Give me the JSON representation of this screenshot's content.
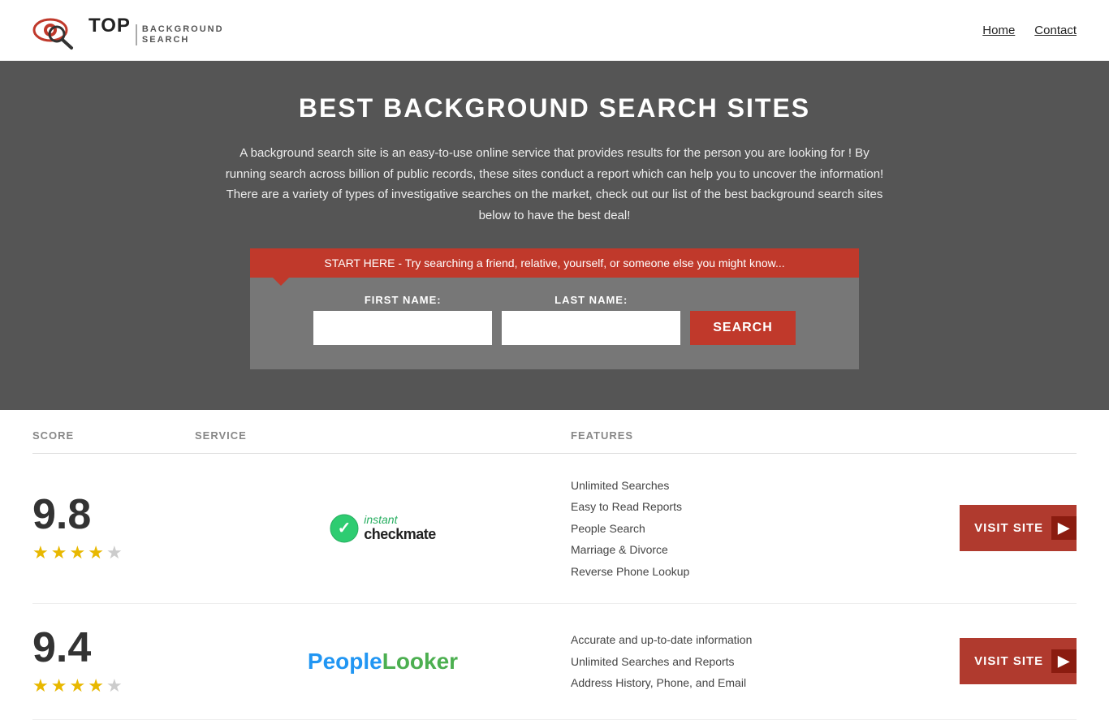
{
  "header": {
    "logo_top": "TOP",
    "logo_sub1": "BACKGROUND",
    "logo_sub2": "SEARCH",
    "nav_home": "Home",
    "nav_contact": "Contact"
  },
  "hero": {
    "title": "BEST BACKGROUND SEARCH SITES",
    "description": "A background search site is an easy-to-use online service that provides results  for the person you are looking for ! By  running  search across billion of public records, these sites conduct  a report which can help you to uncover the information! There are a variety of types of investigative searches on the market, check out our  list of the best background search sites below to have the best deal!",
    "search_banner": "START HERE - Try searching a friend, relative, yourself, or someone else you might know...",
    "first_name_label": "FIRST NAME:",
    "last_name_label": "LAST NAME:",
    "search_button": "SEARCH"
  },
  "table": {
    "col_score": "SCORE",
    "col_service": "SERVICE",
    "col_features": "FEATURES",
    "col_action": ""
  },
  "results": [
    {
      "score": "9.8",
      "stars": 4,
      "service_name": "Instant Checkmate",
      "features": [
        "Unlimited Searches",
        "Easy to Read Reports",
        "People Search",
        "Marriage & Divorce",
        "Reverse Phone Lookup"
      ],
      "visit_label": "VISIT SITE"
    },
    {
      "score": "9.4",
      "stars": 4,
      "service_name": "PeopleLooker",
      "features": [
        "Accurate and up-to-date information",
        "Unlimited Searches and Reports",
        "Address History, Phone, and Email"
      ],
      "visit_label": "VISIT SITE"
    }
  ]
}
